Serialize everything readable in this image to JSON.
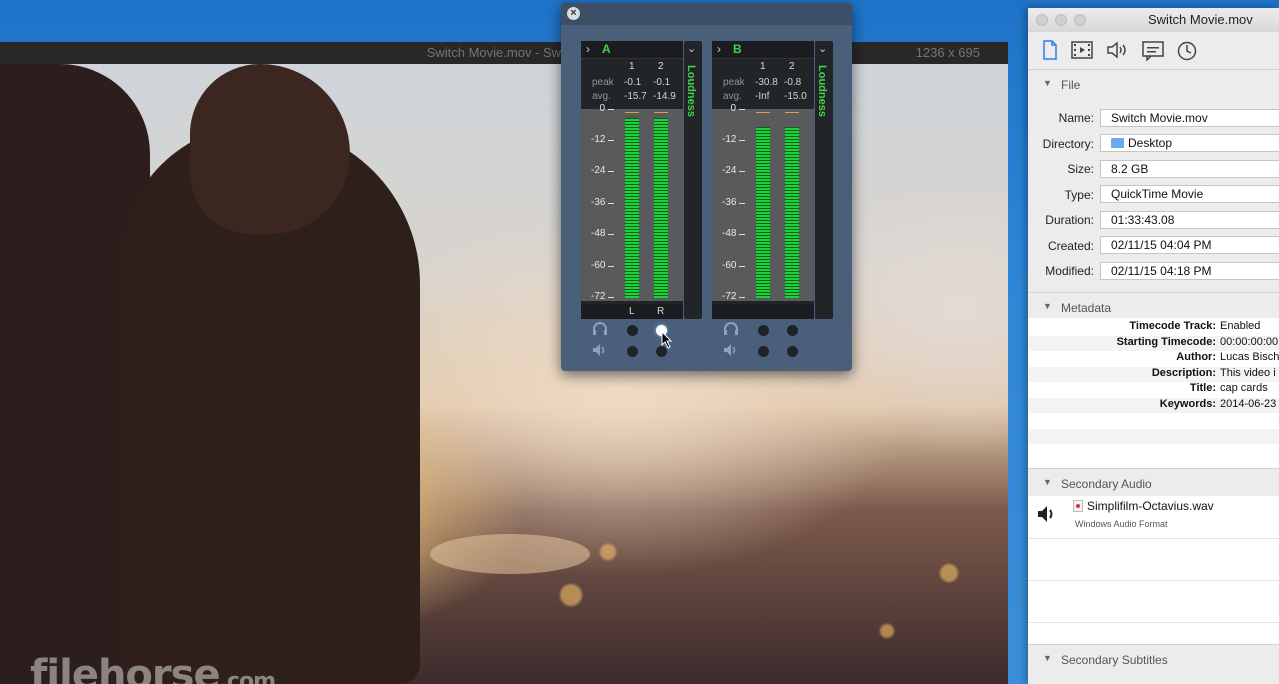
{
  "video_window": {
    "title": "Switch Movie.mov - Switch",
    "size_label": "1236 x 695",
    "watermark_main": "filehorse",
    "watermark_suffix": ".com"
  },
  "meter_panel": {
    "close_label": "×",
    "meters": [
      {
        "name": "A",
        "channels": [
          "1",
          "2"
        ],
        "peak_label": "peak",
        "avg_label": "avg.",
        "peak": [
          "-0.1",
          "-0.1"
        ],
        "avg": [
          "-15.7",
          "-14.9"
        ],
        "levels": [
          0.98,
          0.98
        ],
        "footer": [
          "L",
          "R"
        ],
        "loudness_label": "Loudness"
      },
      {
        "name": "B",
        "channels": [
          "1",
          "2"
        ],
        "peak_label": "peak",
        "avg_label": "avg.",
        "peak": [
          "-30.8",
          "-0.8"
        ],
        "avg": [
          "-Inf",
          "-15.0"
        ],
        "levels": [
          0.93,
          0.93
        ],
        "footer": [
          "",
          ""
        ],
        "loudness_label": "Loudness"
      }
    ],
    "scale_ticks": [
      "0",
      "-12",
      "-24",
      "-36",
      "-48",
      "-60",
      "-72"
    ]
  },
  "inspector": {
    "title": "Switch Movie.mov",
    "toolbar_icons": [
      "document-icon",
      "film-icon",
      "speaker-icon",
      "subtitle-icon",
      "clock-icon"
    ],
    "file_section": {
      "title": "File",
      "fields": [
        {
          "label": "Name:",
          "value": "Switch Movie.mov"
        },
        {
          "label": "Directory:",
          "value": "Desktop"
        },
        {
          "label": "Size:",
          "value": "8.2 GB"
        },
        {
          "label": "Type:",
          "value": "QuickTime Movie"
        },
        {
          "label": "Duration:",
          "value": "01:33:43.08"
        },
        {
          "label": "Created:",
          "value": "02/11/15 04:04 PM"
        },
        {
          "label": "Modified:",
          "value": "02/11/15 04:18 PM"
        }
      ]
    },
    "metadata_section": {
      "title": "Metadata",
      "rows": [
        {
          "key": "Timecode Track:",
          "value": "Enabled"
        },
        {
          "key": "Starting Timecode:",
          "value": "00:00:00:00"
        },
        {
          "key": "Author:",
          "value": "Lucas Bischoff"
        },
        {
          "key": "Description:",
          "value": "This video i"
        },
        {
          "key": "Title:",
          "value": "cap cards"
        },
        {
          "key": "Keywords:",
          "value": "2014-06-23"
        }
      ]
    },
    "secondary_audio_section": {
      "title": "Secondary Audio",
      "file_name": "Simplifilm-Octavius.wav",
      "file_format": "Windows Audio Format"
    },
    "secondary_subtitles_section": {
      "title": "Secondary Subtitles"
    }
  }
}
